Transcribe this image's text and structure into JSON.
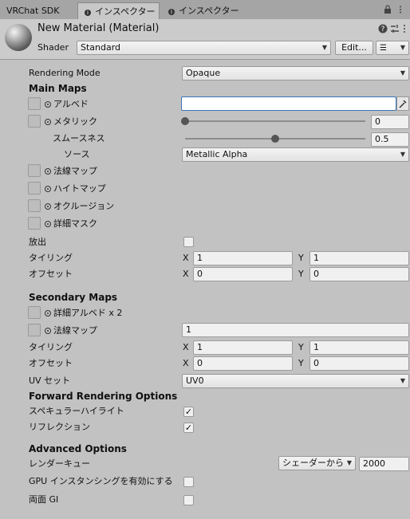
{
  "tabs": [
    {
      "label": "VRChat SDK"
    },
    {
      "label": "インスペクター"
    },
    {
      "label": "インスペクター"
    }
  ],
  "header": {
    "title": "New Material (Material)",
    "shader_label": "Shader",
    "shader_value": "Standard",
    "edit_button": "Edit..."
  },
  "rendering_mode": {
    "label": "Rendering Mode",
    "value": "Opaque"
  },
  "main_maps": {
    "heading": "Main Maps",
    "albedo": "アルベド",
    "metallic": "メタリック",
    "metallic_value": "0",
    "metallic_level": 0,
    "smoothness": "スムースネス",
    "smoothness_value": "0.5",
    "smoothness_level": 0.5,
    "source_label": "ソース",
    "source_value": "Metallic Alpha",
    "normal_map": "法線マップ",
    "height_map": "ハイトマップ",
    "occlusion": "オクルージョン",
    "detail_mask": "詳細マスク",
    "emission": "放出",
    "tiling_label": "タイリング",
    "tiling_x": "1",
    "tiling_y": "1",
    "offset_label": "オフセット",
    "offset_x": "0",
    "offset_y": "0"
  },
  "secondary_maps": {
    "heading": "Secondary Maps",
    "detail_albedo": "詳細アルベド x 2",
    "normal_map": "法線マップ",
    "normal_value": "1",
    "tiling_label": "タイリング",
    "tiling_x": "1",
    "tiling_y": "1",
    "offset_label": "オフセット",
    "offset_x": "0",
    "offset_y": "0",
    "uv_label": "UV セット",
    "uv_value": "UV0"
  },
  "forward": {
    "heading": "Forward Rendering Options",
    "specular": "スペキュラーハイライト",
    "reflection": "リフレクション"
  },
  "advanced": {
    "heading": "Advanced Options",
    "render_queue_label": "レンダーキュー",
    "render_queue_mode": "シェーダーから",
    "render_queue_value": "2000",
    "gpu_instancing": "GPU インスタンシングを有効にする",
    "double_sided_gi": "両面 GI"
  },
  "axis": {
    "x": "X",
    "y": "Y"
  }
}
